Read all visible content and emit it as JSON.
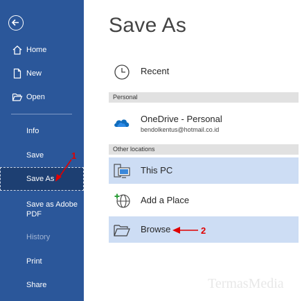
{
  "sidebar": {
    "back_label": "",
    "items": [
      {
        "label": "Home"
      },
      {
        "label": "New"
      },
      {
        "label": "Open"
      },
      {
        "label": "Info"
      },
      {
        "label": "Save"
      },
      {
        "label": "Save As"
      },
      {
        "label": "Save as Adobe\nPDF"
      },
      {
        "label": "History"
      },
      {
        "label": "Print"
      },
      {
        "label": "Share"
      }
    ]
  },
  "main": {
    "title": "Save As",
    "recent_label": "Recent",
    "personal_header": "Personal",
    "onedrive": {
      "label": "OneDrive - Personal",
      "account": "bendolkentus@hotmail.co.id"
    },
    "other_header": "Other locations",
    "locations": [
      {
        "label": "This PC"
      },
      {
        "label": "Add a Place"
      },
      {
        "label": "Browse"
      }
    ]
  },
  "annotations": {
    "step1": "1",
    "step2": "2"
  },
  "watermark": "TermasMedia",
  "colors": {
    "sidebar_bg": "#2b579a",
    "sidebar_active": "#1d3f72",
    "selected_row": "#cdddf4",
    "annotation": "#e00000"
  }
}
